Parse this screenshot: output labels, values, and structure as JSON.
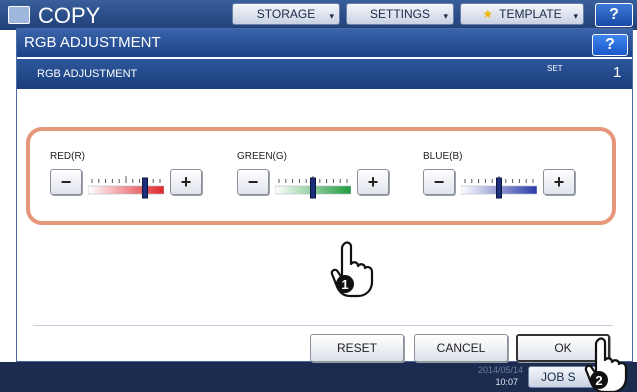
{
  "background": {
    "app_title": "COPY",
    "tabs": [
      {
        "label": "STORAGE"
      },
      {
        "label": "SETTINGS"
      },
      {
        "label": "TEMPLATE"
      }
    ],
    "help_label": "?",
    "clock": {
      "date": "2014/05/14",
      "time": "10:07"
    },
    "job_status_label": "JOB S"
  },
  "dialog": {
    "title": "RGB ADJUSTMENT",
    "help_label": "?",
    "subtitle": "RGB ADJUSTMENT",
    "set_label": "SET",
    "set_value": "1"
  },
  "channels": [
    {
      "label": "RED(R)",
      "minus": "−",
      "plus": "+",
      "level_fraction": 0.78,
      "color": "#e0262a"
    },
    {
      "label": "GREEN(G)",
      "minus": "−",
      "plus": "+",
      "level_fraction": 0.5,
      "color": "#1f9c3c"
    },
    {
      "label": "BLUE(B)",
      "minus": "−",
      "plus": "+",
      "level_fraction": 0.5,
      "color": "#2a3aa8"
    }
  ],
  "buttons": {
    "reset": "RESET",
    "cancel": "CANCEL",
    "ok": "OK"
  },
  "callouts": [
    {
      "number": "1"
    },
    {
      "number": "2"
    }
  ],
  "colors": {
    "panel_outline": "#e6977b",
    "titlebar": "#1d4286"
  }
}
